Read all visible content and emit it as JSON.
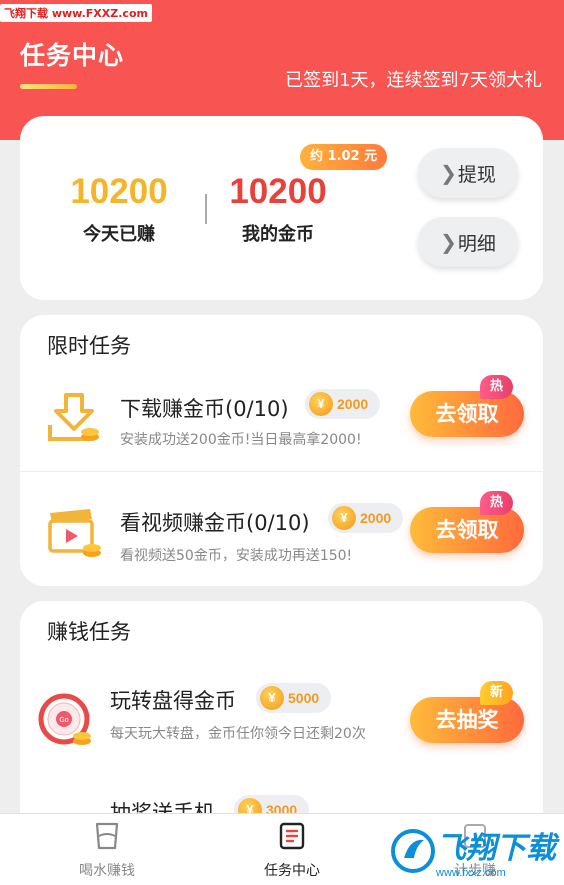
{
  "watermark": "飞翔下载 www.FXXZ.com",
  "header": {
    "title": "任务中心",
    "checkin_text": "已签到1天，连续签到7天领大礼"
  },
  "coins": {
    "today_value": "10200",
    "today_label": "今天已赚",
    "mine_value": "10200",
    "mine_label": "我的金币",
    "yuan_badge": "约 1.02 元",
    "withdraw_label": "提现",
    "detail_label": "明细"
  },
  "limited": {
    "title": "限时任务",
    "tasks": [
      {
        "title": "下载赚金币(0/10)",
        "coins": "2000",
        "desc": "安装成功送200金币!当日最高拿2000!",
        "button": "去领取",
        "tag": "热"
      },
      {
        "title": "看视频赚金币(0/10)",
        "coins": "2000",
        "desc": "看视频送50金币，安装成功再送150!",
        "button": "去领取",
        "tag": "热"
      }
    ]
  },
  "earn": {
    "title": "赚钱任务",
    "tasks": [
      {
        "title": "玩转盘得金币",
        "coins": "5000",
        "desc": "每天玩大转盘，金币任你领今日还剩20次",
        "button": "去抽奖",
        "tag": "新",
        "wheel_label": "Go"
      },
      {
        "title": "抽奖送手机",
        "coins": "3000"
      }
    ]
  },
  "coin_symbol": "¥",
  "tabbar": {
    "tabs": [
      {
        "label": "喝水赚钱"
      },
      {
        "label": "任务中心"
      },
      {
        "label": "计步赚"
      }
    ]
  },
  "site_logo": {
    "text": "飞翔下载",
    "url": "www.fxxz.com"
  },
  "colors": {
    "header": "#f85451",
    "gold": "#f5b528",
    "red": "#e8413c",
    "button": "#ff8a3a"
  }
}
